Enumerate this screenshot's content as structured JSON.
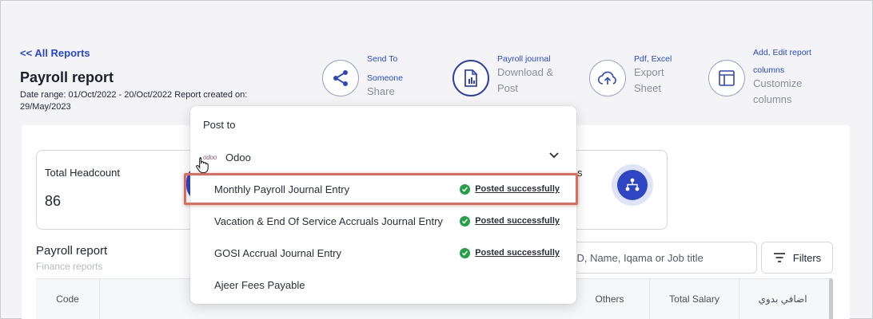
{
  "header": {
    "back_link": "<< All Reports",
    "title": "Payroll report",
    "date_range": "Date range: 01/Oct/2022 - 20/Oct/2022 Report created on: 29/May/2023"
  },
  "actions": [
    {
      "small": "Send To",
      "small2": "Someone",
      "big": "Share",
      "icon": "share-icon"
    },
    {
      "small": "Payroll journal",
      "big": "Download &",
      "big2": "Post",
      "icon": "document-chart-icon"
    },
    {
      "small": "Pdf, Excel",
      "big": "Export",
      "big2": "Sheet",
      "icon": "cloud-upload-icon"
    },
    {
      "small": "Add, Edit report",
      "small2": "columns",
      "big": "Customize",
      "big2": "columns",
      "icon": "columns-icon"
    }
  ],
  "stats": {
    "headcount_label": "Total Headcount",
    "headcount_value": "86",
    "right_label_suffix": "s"
  },
  "section": {
    "title": "Payroll report",
    "subtitle": "Finance reports"
  },
  "search": {
    "placeholder": "e ID, Name, Iqama or Job title"
  },
  "filters_label": "Filters",
  "table": {
    "columns": [
      "Code",
      "Others",
      "Total Salary",
      "اضافي بدوي"
    ]
  },
  "dropdown": {
    "title": "Post to",
    "provider_logo": "odoo",
    "provider": "Odoo",
    "entries": [
      {
        "name": "Monthly Payroll Journal Entry",
        "status": "Posted successfully"
      },
      {
        "name": "Vacation & End Of Service Accruals Journal Entry",
        "status": "Posted successfully"
      },
      {
        "name": "GOSI Accrual Journal Entry",
        "status": "Posted successfully"
      },
      {
        "name": "Ajeer Fees Payable",
        "status": ""
      }
    ]
  },
  "colors": {
    "accent": "#2f45c4",
    "link": "#2746d8",
    "success": "#24a148",
    "highlight": "#e06a5c"
  }
}
